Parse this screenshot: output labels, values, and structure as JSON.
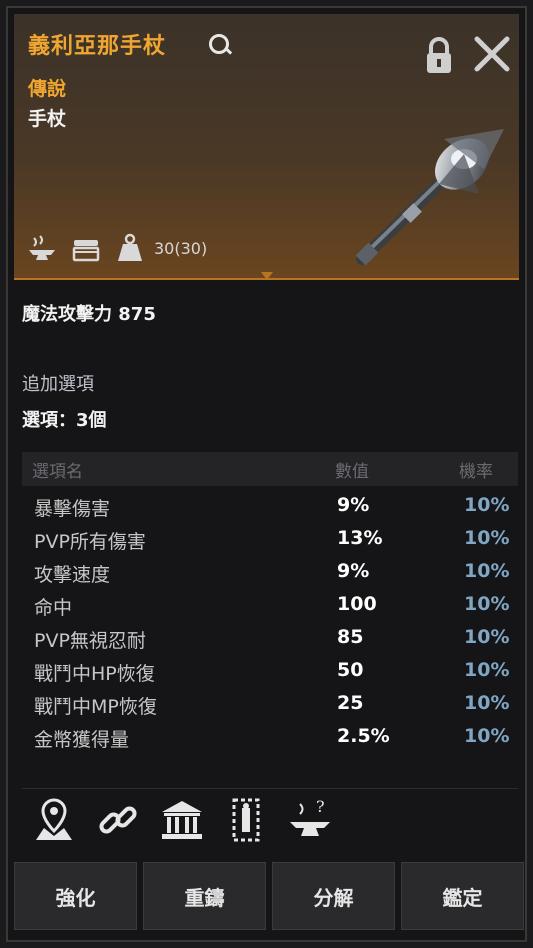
{
  "item": {
    "name": "義利亞那手杖",
    "rarity": "傳說",
    "type": "手杖",
    "weight": "30(30)"
  },
  "header_icons": [
    "anvil-icon",
    "chest-icon",
    "weight-icon"
  ],
  "stats": {
    "attack": "魔法攻擊力 875"
  },
  "extra_options": {
    "title": "追加選項",
    "count": "選項：3個",
    "columns": {
      "name": "選項名",
      "value": "數值",
      "rate": "機率"
    },
    "rows": [
      {
        "name": "暴擊傷害",
        "value": "9%",
        "rate": "10%"
      },
      {
        "name": "PVP所有傷害",
        "value": "13%",
        "rate": "10%"
      },
      {
        "name": "攻擊速度",
        "value": "9%",
        "rate": "10%"
      },
      {
        "name": "命中",
        "value": "100",
        "rate": "10%"
      },
      {
        "name": "PVP無視忍耐",
        "value": "85",
        "rate": "10%"
      },
      {
        "name": "戰鬥中HP恢復",
        "value": "50",
        "rate": "10%"
      },
      {
        "name": "戰鬥中MP恢復",
        "value": "25",
        "rate": "10%"
      },
      {
        "name": "金幣獲得量",
        "value": "2.5%",
        "rate": "10%"
      }
    ]
  },
  "bottom_icons": [
    "map-pin-icon",
    "link-icon",
    "bank-icon",
    "scroll-icon",
    "anvil-question-icon"
  ],
  "buttons": {
    "enhance": "強化",
    "reforge": "重鑄",
    "decompose": "分解",
    "appraise": "鑑定"
  },
  "colors": {
    "legendary": "#f0a630",
    "rate": "#7fa6c4"
  }
}
